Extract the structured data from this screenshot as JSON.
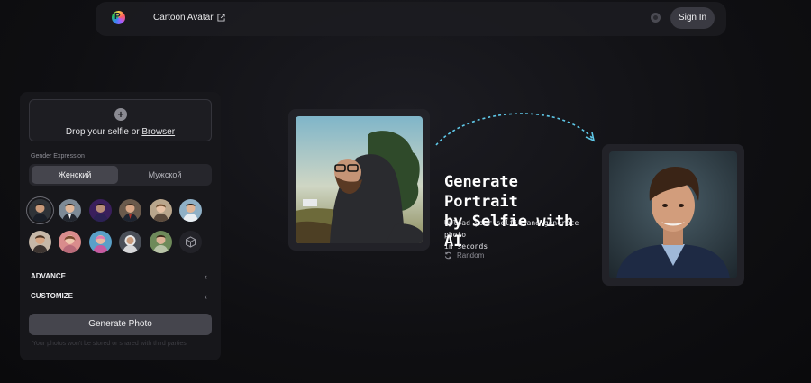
{
  "header": {
    "nav_link": "Cartoon Avatar",
    "sign_in": "Sign In"
  },
  "upload": {
    "drop_prefix": "Drop your selfie or ",
    "browser_link": "Browser"
  },
  "gender": {
    "label": "Gender Expression",
    "options": [
      "Женский",
      "Мужской"
    ],
    "selected": "Женский"
  },
  "styles": {
    "count_shown": 11
  },
  "sections": {
    "advance": "ADVANCE",
    "customize": "CUSTOMIZE"
  },
  "actions": {
    "generate": "Generate Photo",
    "disclaimer": "Your photos won't be stored or shared with third parties"
  },
  "hero": {
    "headline_line1": "Generate Portrait",
    "headline_line2": "by Selfie with AI",
    "sub_line1": "Upload your selfie and generate photo",
    "sub_line2": "in seconds",
    "random": "Random"
  },
  "icons": [
    "logo-icon",
    "external-link-icon",
    "gear-icon",
    "plus-icon",
    "cube-icon",
    "chevron-left-icon",
    "refresh-icon",
    "curved-arrow-icon"
  ],
  "colors": {
    "accent_arrow": "#5fc8e8",
    "button_bg": "#45454d"
  }
}
